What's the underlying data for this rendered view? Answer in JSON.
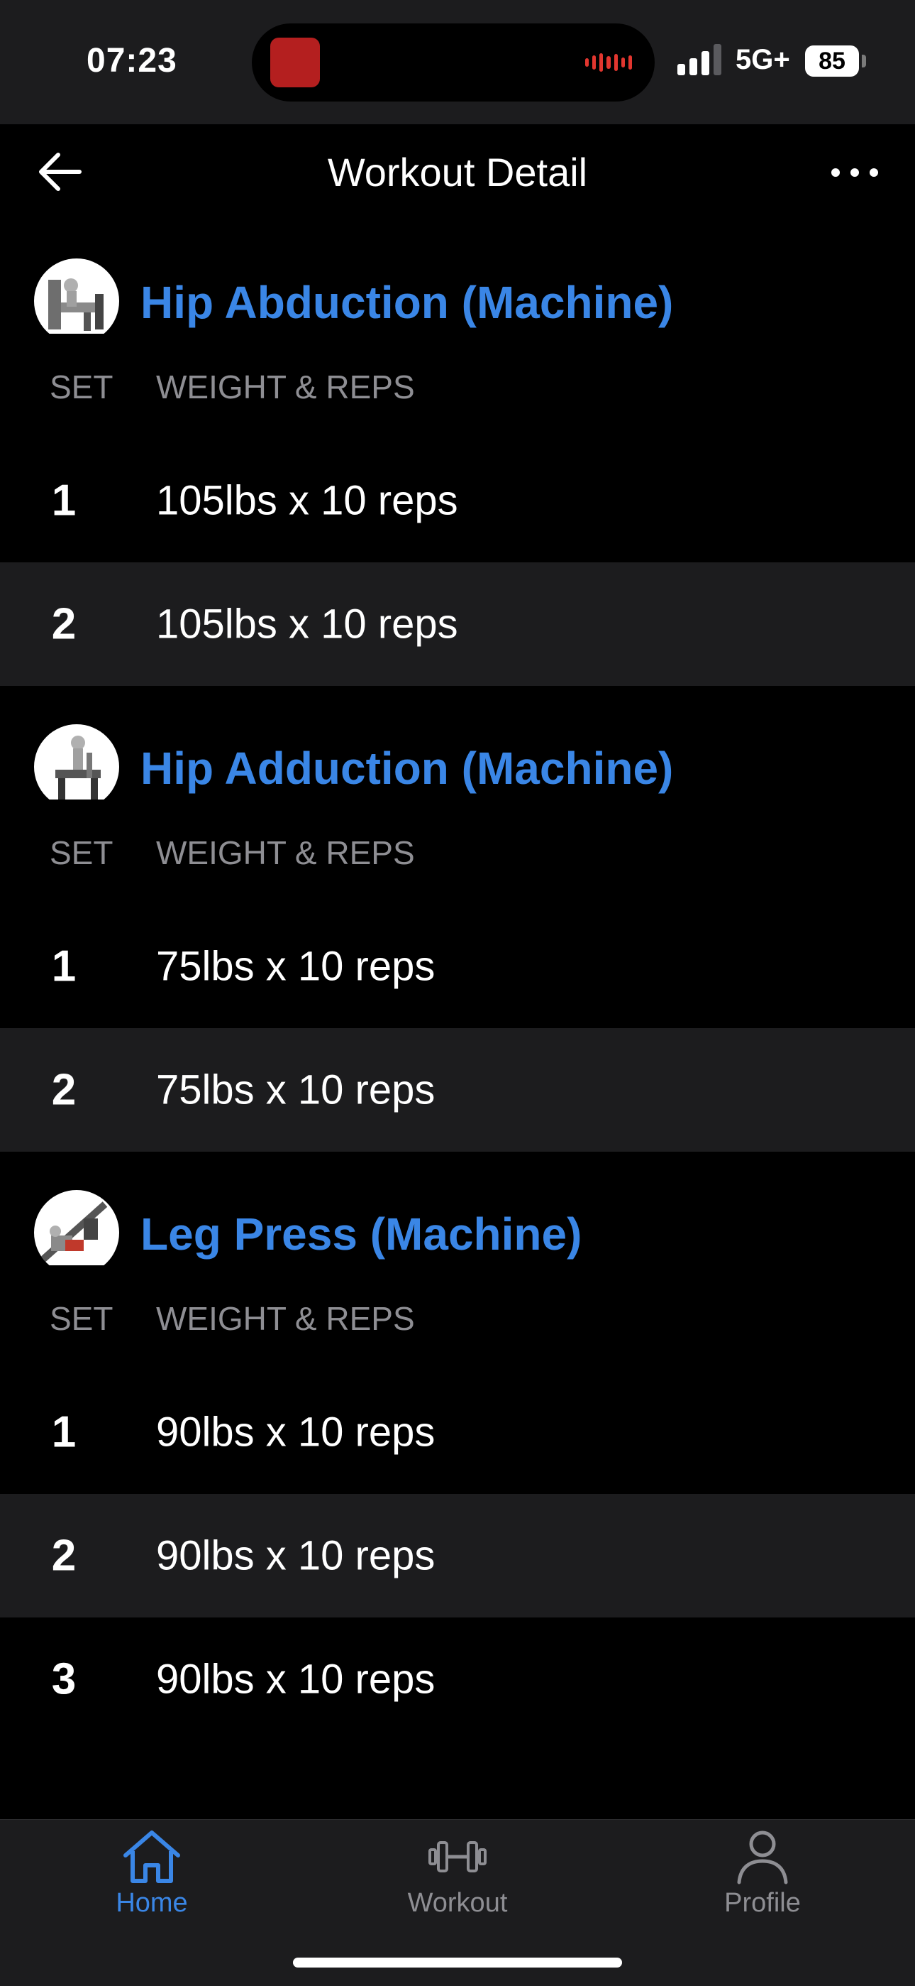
{
  "status_bar": {
    "time": "07:23",
    "carrier": "5G+",
    "battery": "85"
  },
  "nav": {
    "title": "Workout Detail",
    "back_icon": "arrow-left-icon",
    "more_icon": "ellipsis-icon"
  },
  "columns": {
    "set": "SET",
    "weight_reps": "WEIGHT & REPS"
  },
  "exercises": [
    {
      "title": "Hip Abduction (Machine)",
      "sets": [
        {
          "num": "1",
          "value": "105lbs x 10 reps"
        },
        {
          "num": "2",
          "value": "105lbs x 10 reps"
        }
      ]
    },
    {
      "title": "Hip Adduction (Machine)",
      "sets": [
        {
          "num": "1",
          "value": "75lbs x 10 reps"
        },
        {
          "num": "2",
          "value": "75lbs x 10 reps"
        }
      ]
    },
    {
      "title": "Leg Press (Machine)",
      "sets": [
        {
          "num": "1",
          "value": "90lbs x 10 reps"
        },
        {
          "num": "2",
          "value": "90lbs x 10 reps"
        },
        {
          "num": "3",
          "value": "90lbs x 10 reps"
        }
      ]
    }
  ],
  "tabs": [
    {
      "label": "Home",
      "icon": "home-icon",
      "active": true
    },
    {
      "label": "Workout",
      "icon": "dumbbell-icon",
      "active": false
    },
    {
      "label": "Profile",
      "icon": "person-icon",
      "active": false
    }
  ],
  "colors": {
    "accent": "#3a86e6",
    "row_alt": "#1c1c1e",
    "muted": "#8e8e93"
  }
}
